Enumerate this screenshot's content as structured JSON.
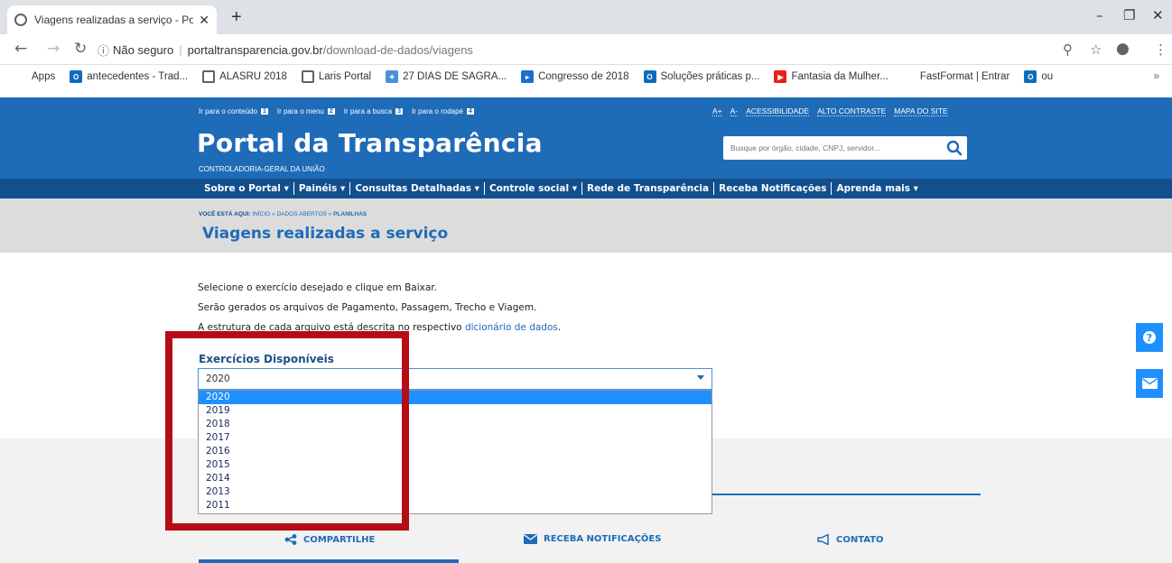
{
  "browser": {
    "tab_title": "Viagens realizadas a serviço - Po",
    "new_tab_label": "+",
    "security_label": "Não seguro",
    "url_host": "portaltransparencia.gov.br",
    "url_path": "/download-de-dados/viagens",
    "bookmarks": [
      {
        "label": "Apps",
        "icon": "apps-grid-icon"
      },
      {
        "label": "antecedentes - Trad...",
        "icon": "outlook-icon"
      },
      {
        "label": "ALASRU 2018",
        "icon": "globe-icon"
      },
      {
        "label": "Laris Portal",
        "icon": "globe-icon"
      },
      {
        "label": "27 DIAS DE SAGRA...",
        "icon": "grid-logo-icon"
      },
      {
        "label": "Congresso de 2018",
        "icon": "blue-square-icon"
      },
      {
        "label": "Soluções práticas p...",
        "icon": "outlook-icon"
      },
      {
        "label": "Fantasia da Mulher...",
        "icon": "youtube-icon"
      },
      {
        "label": "FastFormat | Entrar",
        "icon": "fastformat-icon"
      },
      {
        "label": "ou",
        "icon": "outlook-icon"
      }
    ],
    "bookmarks_overflow": "»"
  },
  "portal": {
    "access_links": [
      {
        "label": "Ir para o conteúdo",
        "key": "1"
      },
      {
        "label": "Ir para o menu",
        "key": "2"
      },
      {
        "label": "Ir para a busca",
        "key": "3"
      },
      {
        "label": "Ir para o rodapé",
        "key": "4"
      }
    ],
    "util_links": [
      "A+",
      "A-",
      "ACESSIBILIDADE",
      "ALTO CONTRASTE",
      "MAPA DO SITE"
    ],
    "title": "Portal da Transparência",
    "subtitle": "CONTROLADORIA-GERAL DA UNIÃO",
    "search_placeholder": "Busque por órgão, cidade, CNPJ, servidor...",
    "nav": [
      "Sobre o Portal ▾",
      "Painéis ▾",
      "Consultas Detalhadas ▾",
      "Controle social ▾",
      "Rede de Transparência",
      "Receba Notificações",
      "Aprenda mais ▾"
    ]
  },
  "breadcrumb": {
    "lead": "VOCÊ ESTÁ AQUI:",
    "path": "INÍCIO » DADOS ABERTOS » ",
    "current": "PLANILHAS"
  },
  "page": {
    "title": "Viagens realizadas a serviço",
    "p1": "Selecione o exercício desejado e clique em Baixar.",
    "p2": "Serão gerados os arquivos de Pagamento, Passagem, Trecho e Viagem.",
    "p3_prefix": "A estrutura de cada arquivo está descrita no respectivo ",
    "p3_link": "dicionário de dados",
    "p3_suffix": "."
  },
  "select": {
    "label": "Exercícios Disponíveis",
    "value": "2020",
    "options": [
      "2020",
      "2019",
      "2018",
      "2017",
      "2016",
      "2015",
      "2014",
      "2013",
      "2011"
    ],
    "selected_index": 0
  },
  "footer": {
    "share": "COMPARTILHE",
    "notifications": "RECEBA NOTIFICAÇÕES",
    "contact": "CONTATO"
  },
  "colors": {
    "header_blue": "#1e6bb8",
    "nav_dark": "#134f8d",
    "highlight_red": "#b50d15",
    "option_selected": "#1e90ff"
  }
}
